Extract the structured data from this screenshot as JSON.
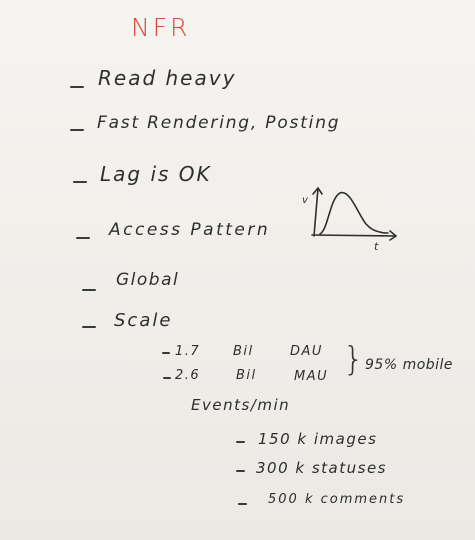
{
  "title": "NFR",
  "items": [
    {
      "text": "Read heavy"
    },
    {
      "text": "Fast Rendering, Posting"
    },
    {
      "text": "Lag is OK"
    },
    {
      "text": "Access Pattern"
    },
    {
      "text": "Global"
    },
    {
      "text": "Scale"
    }
  ],
  "graph": {
    "y_label": "v",
    "x_label": "t"
  },
  "scale_rows": [
    {
      "value": "1.7",
      "unit": "Bil",
      "metric": "DAU"
    },
    {
      "value": "2.6",
      "unit": "Bil",
      "metric": "MAU"
    }
  ],
  "brace": "}",
  "mobile_note": "95% mobile",
  "events_header": "Events/min",
  "events": [
    {
      "text": "150 k images"
    },
    {
      "text": "300 k statuses"
    },
    {
      "text": "500 k comments"
    }
  ],
  "colors": {
    "title": "#d9463b",
    "ink": "#2e2e2e",
    "background": "#f2f0ec"
  }
}
